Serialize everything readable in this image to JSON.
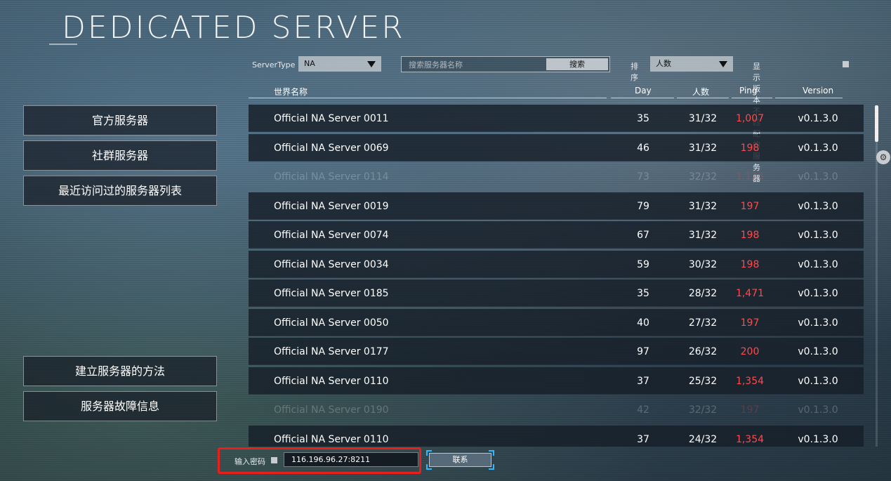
{
  "title": "DEDICATED SERVER",
  "filters": {
    "server_type_label": "ServerType",
    "server_type_value": "NA",
    "search_placeholder": "搜索服务器名称",
    "search_button": "搜索",
    "sort_label": "排序",
    "sort_value": "人数",
    "show_mismatch_label": "显示版本不匹配的服务器"
  },
  "sidebar": {
    "items": [
      "官方服务器",
      "社群服务器",
      "最近访问过的服务器列表"
    ],
    "bottom_items": [
      "建立服务器的方法",
      "服务器故障信息"
    ]
  },
  "table": {
    "columns": [
      "世界名称",
      "Day",
      "人数",
      "Ping",
      "Version"
    ],
    "rows": [
      {
        "name": "Official NA Server 0011",
        "day": "35",
        "players": "31/32",
        "ping": "1,007",
        "version": "v0.1.3.0",
        "dim": false
      },
      {
        "name": "Official NA Server 0069",
        "day": "46",
        "players": "31/32",
        "ping": "198",
        "version": "v0.1.3.0",
        "dim": false
      },
      {
        "name": "Official NA Server 0114",
        "day": "73",
        "players": "32/32",
        "ping": "1,125",
        "version": "v0.1.3.0",
        "dim": true
      },
      {
        "name": "Official NA Server 0019",
        "day": "79",
        "players": "31/32",
        "ping": "197",
        "version": "v0.1.3.0",
        "dim": false
      },
      {
        "name": "Official NA Server 0074",
        "day": "67",
        "players": "31/32",
        "ping": "198",
        "version": "v0.1.3.0",
        "dim": false
      },
      {
        "name": "Official NA Server 0034",
        "day": "59",
        "players": "30/32",
        "ping": "198",
        "version": "v0.1.3.0",
        "dim": false
      },
      {
        "name": "Official NA Server 0185",
        "day": "35",
        "players": "28/32",
        "ping": "1,471",
        "version": "v0.1.3.0",
        "dim": false
      },
      {
        "name": "Official NA Server 0050",
        "day": "40",
        "players": "27/32",
        "ping": "197",
        "version": "v0.1.3.0",
        "dim": false
      },
      {
        "name": "Official NA Server 0177",
        "day": "97",
        "players": "26/32",
        "ping": "200",
        "version": "v0.1.3.0",
        "dim": false
      },
      {
        "name": "Official NA Server 0110",
        "day": "37",
        "players": "25/32",
        "ping": "1,354",
        "version": "v0.1.3.0",
        "dim": false
      },
      {
        "name": "Official NA Server 0190",
        "day": "42",
        "players": "32/32",
        "ping": "197",
        "version": "v0.1.3.0",
        "dim": true
      },
      {
        "name": "Official NA Server 0110",
        "day": "37",
        "players": "24/32",
        "ping": "1,354",
        "version": "v0.1.3.0",
        "dim": false
      }
    ]
  },
  "bottom": {
    "password_label": "输入密码",
    "address_value": "116.196.96.27:8211",
    "connect_button": "联系"
  },
  "colors": {
    "ping_red": "#ff4a4a",
    "highlight_box": "#e8201c",
    "connect_corner": "#2fb7ff"
  }
}
